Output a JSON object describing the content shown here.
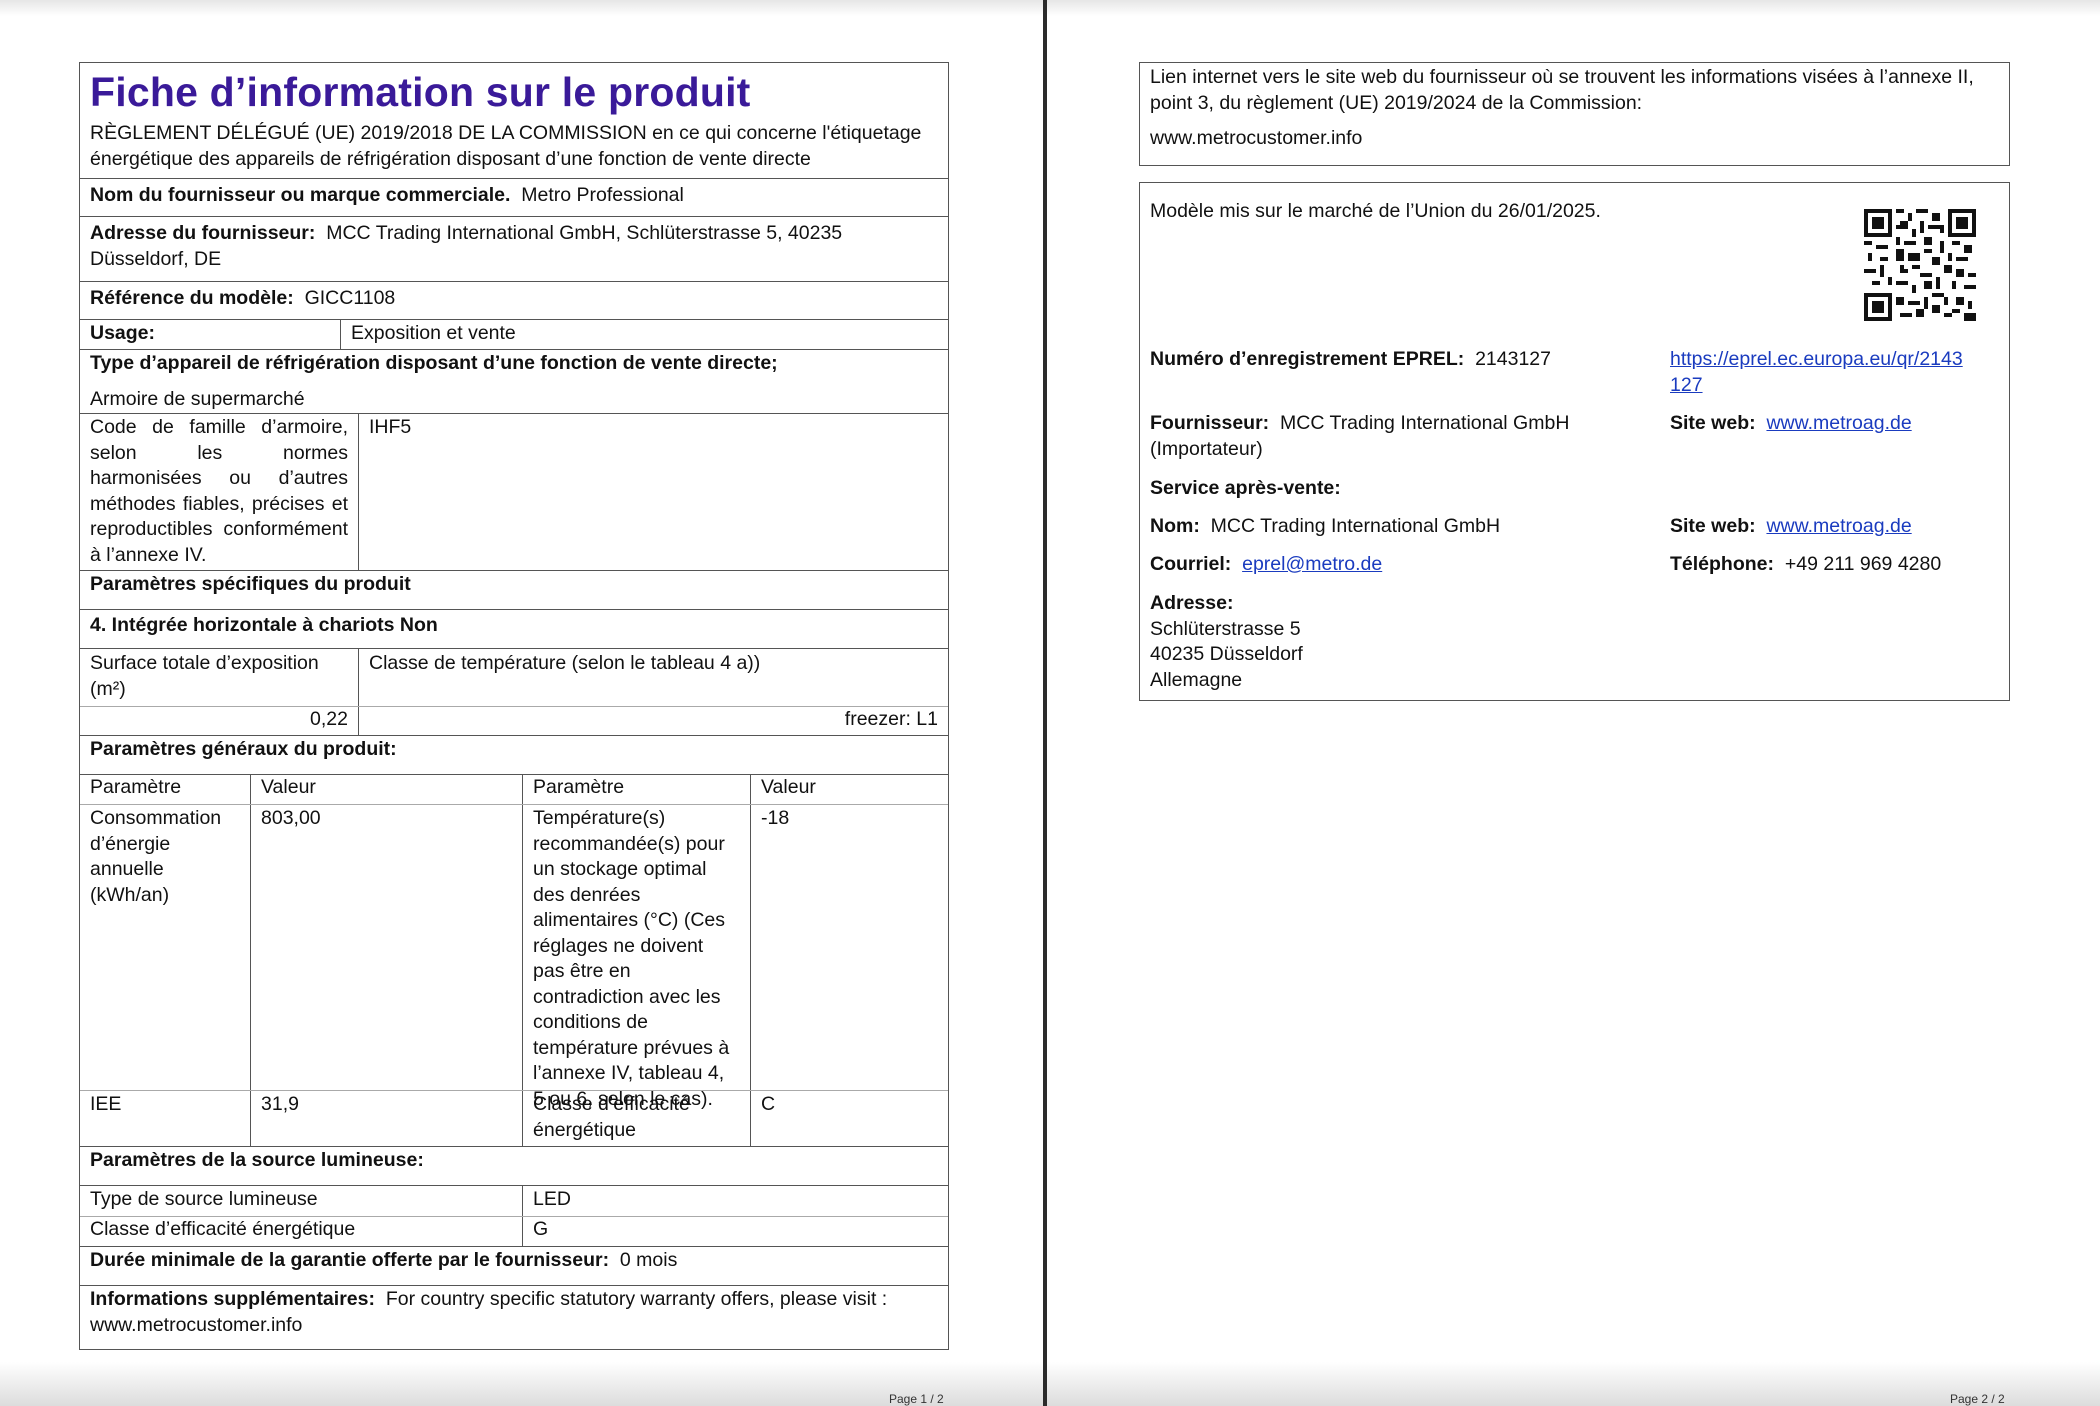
{
  "page1": {
    "title": "Fiche d’information sur le produit",
    "regulation": "RÈGLEMENT DÉLÉGUÉ (UE) 2019/2018 DE LA COMMISSION en ce qui concerne l'étiquetage énergétique des appareils de réfrigération disposant d’une fonction de vente directe",
    "supplier_name_label": "Nom du fournisseur ou marque commerciale.",
    "supplier_name_value": "Metro Professional",
    "supplier_address_label": "Adresse du fournisseur:",
    "supplier_address_value": "MCC Trading International GmbH, Schlüterstrasse 5, 40235 Düsseldorf, DE",
    "model_ref_label": "Référence du modèle:",
    "model_ref_value": "GICC1108",
    "usage_label": "Usage:",
    "usage_value": "Exposition et vente",
    "type_heading": "Type d’appareil de réfrigération disposant d’une fonction de vente directe;",
    "type_value": "Armoire de supermarché",
    "family_code_label": "Code de famille d’armoire, selon les normes harmonisées ou d’autres méthodes fiables, précises et reproductibles conformément à l’annexe IV.",
    "family_code_value": "IHF5",
    "specific_params_heading": "Paramètres spécifiques du produit",
    "integrated_heading": "4. Intégrée horizontale à chariots Non",
    "display_area_label": "Surface totale d’exposition (m²)",
    "display_area_value": "0,22",
    "temp_class_label": "Classe de température (selon le tableau 4 a))",
    "temp_class_value": "freezer: L1",
    "general_params_heading": "Paramètres généraux du produit:",
    "general_table": {
      "headers": [
        "Paramètre",
        "Valeur",
        "Paramètre",
        "Valeur"
      ],
      "rows": [
        [
          "Consommation d’énergie annuelle (kWh/an)",
          "803,00",
          "Température(s) recommandée(s) pour un stockage optimal des denrées alimentaires (°C) (Ces réglages ne doivent pas être en contradiction avec les conditions de température prévues à l’annexe IV, tableau 4, 5 ou 6, selon le cas).",
          "-18"
        ],
        [
          "IEE",
          "31,9",
          "Classe d’efficacité énergétique",
          "C"
        ]
      ]
    },
    "light_heading": "Paramètres de la source lumineuse:",
    "light_rows": [
      [
        "Type de source lumineuse",
        "LED"
      ],
      [
        "Classe d’efficacité énergétique",
        "G"
      ]
    ],
    "warranty_label": "Durée minimale de la garantie offerte par le fournisseur:",
    "warranty_value": "0 mois",
    "additional_label": "Informations supplémentaires:",
    "additional_value": "For country specific statutory warranty offers, please visit : www.metrocustomer.info",
    "footer": "Page 1 / 2"
  },
  "page2": {
    "link_text": "Lien internet vers le site web du fournisseur où se trouvent les informations visées à l’annexe II, point 3, du règlement (UE) 2019/2024 de la Commission:",
    "link_url": "www.metrocustomer.info",
    "placed_on_market": "Modèle mis sur le marché de l’Union du 26/01/2025.",
    "eprel_label": "Numéro d’enregistrement EPREL:",
    "eprel_value": "2143127",
    "eprel_url": "https://eprel.ec.europa.eu/qr/2143127",
    "supplier_label": "Fournisseur:",
    "supplier_value": "MCC Trading International GmbH (Importateur)",
    "website_label": "Site web:",
    "website_value": "www.metroag.de",
    "after_sales_heading": "Service après-vente:",
    "name_label": "Nom:",
    "name_value": "MCC Trading International GmbH",
    "website2_label": "Site web:",
    "website2_value": "www.metroag.de",
    "email_label": "Courriel:",
    "email_value": "eprel@metro.de",
    "phone_label": "Téléphone:",
    "phone_value": "+49 211 969 4280",
    "address_label": "Adresse:",
    "address_line1": "Schlüterstrasse 5",
    "address_line2": "40235 Düsseldorf",
    "address_line3": "Allemagne",
    "footer": "Page 2 / 2",
    "qr_icon": "qr-code-icon"
  }
}
